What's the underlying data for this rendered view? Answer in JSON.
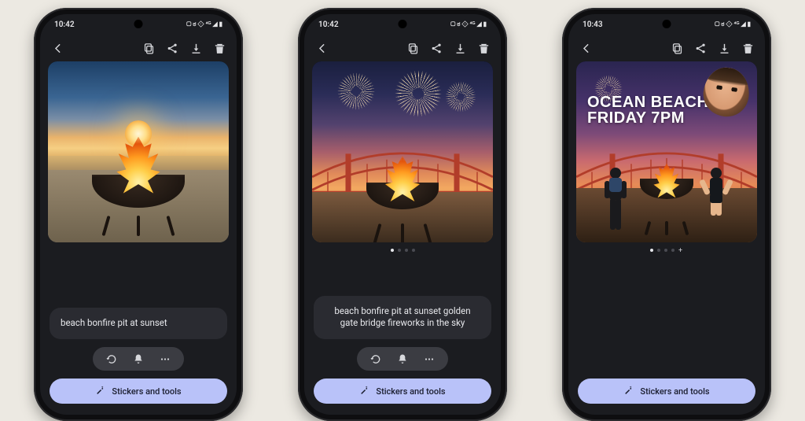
{
  "status_icons_glyphs": "▢ ಠ ⟐ ⁴ᴳ ◢ ▮",
  "phones": [
    {
      "time": "10:42",
      "prompt": "beach bonfire pit at sunset",
      "stickers_label": "Stickers and tools",
      "show_pager": false,
      "show_prompt": true,
      "show_actions": true,
      "overlay_line1": "",
      "overlay_line2": ""
    },
    {
      "time": "10:42",
      "prompt": "beach bonfire pit at sunset golden gate bridge fireworks in the sky",
      "stickers_label": "Stickers and tools",
      "show_pager": true,
      "show_prompt": true,
      "show_actions": true,
      "overlay_line1": "",
      "overlay_line2": ""
    },
    {
      "time": "10:43",
      "prompt": "",
      "stickers_label": "Stickers and tools",
      "show_pager": true,
      "show_prompt": false,
      "show_actions": false,
      "overlay_line1": "OCEAN BEACH",
      "overlay_line2": "FRIDAY 7PM"
    }
  ],
  "toolbar": {
    "back": "back",
    "copy": "copy",
    "share": "share",
    "download": "download",
    "delete": "delete"
  },
  "action_icons": {
    "retry": "retry",
    "variant": "variant",
    "more": "more"
  }
}
